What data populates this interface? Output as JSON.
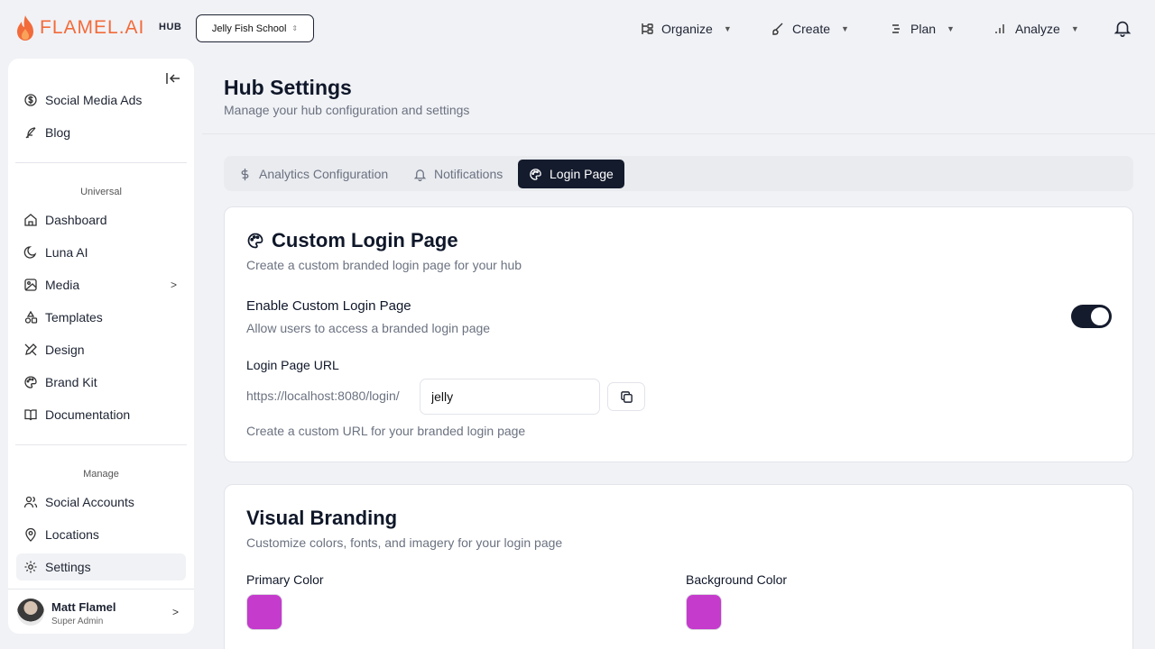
{
  "brand": {
    "logo_text": "FLAMEL.AI",
    "hub_tag": "HUB",
    "accent": "#f26b3a"
  },
  "workspace": {
    "name": "Jelly Fish School"
  },
  "topnav": [
    {
      "label": "Organize"
    },
    {
      "label": "Create"
    },
    {
      "label": "Plan"
    },
    {
      "label": "Analyze"
    }
  ],
  "sidebar": {
    "items_top": [
      {
        "label": "Social Media Ads"
      },
      {
        "label": "Blog"
      }
    ],
    "section_universal": "Universal",
    "items_universal": [
      {
        "label": "Dashboard"
      },
      {
        "label": "Luna AI"
      },
      {
        "label": "Media"
      },
      {
        "label": "Templates"
      },
      {
        "label": "Design"
      },
      {
        "label": "Brand Kit"
      },
      {
        "label": "Documentation"
      }
    ],
    "section_manage": "Manage",
    "items_manage": [
      {
        "label": "Social Accounts"
      },
      {
        "label": "Locations"
      },
      {
        "label": "Settings"
      }
    ],
    "user": {
      "name": "Matt Flamel",
      "role": "Super Admin"
    }
  },
  "header": {
    "title": "Hub Settings",
    "subtitle": "Manage your hub configuration and settings"
  },
  "tabs": [
    {
      "label": "Analytics Configuration"
    },
    {
      "label": "Notifications"
    },
    {
      "label": "Login Page"
    }
  ],
  "custom_login": {
    "title": "Custom Login Page",
    "subtitle": "Create a custom branded login page for your hub",
    "enable_title": "Enable Custom Login Page",
    "enable_desc": "Allow users to access a branded login page",
    "enabled": true,
    "url_label": "Login Page URL",
    "url_prefix": "https://localhost:8080/login/",
    "url_value": "jelly",
    "url_help": "Create a custom URL for your branded login page"
  },
  "visual_branding": {
    "title": "Visual Branding",
    "subtitle": "Customize colors, fonts, and imagery for your login page",
    "primary_label": "Primary Color",
    "primary_color": "#c53bcc",
    "background_label": "Background Color",
    "background_color": "#c53bcc"
  }
}
